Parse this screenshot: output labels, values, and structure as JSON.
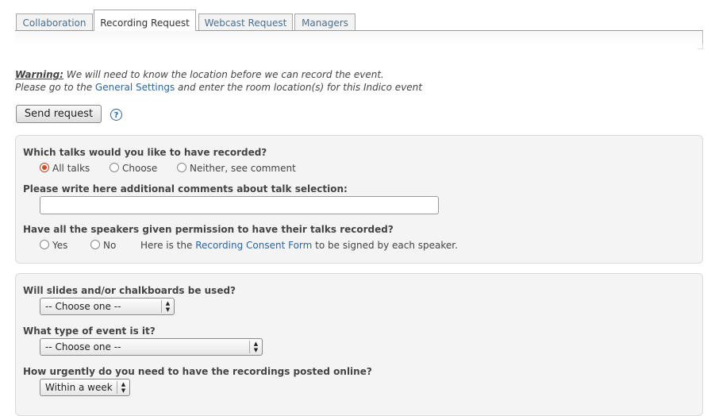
{
  "tabs": [
    {
      "label": "Collaboration"
    },
    {
      "label": "Recording Request"
    },
    {
      "label": "Webcast Request"
    },
    {
      "label": "Managers"
    }
  ],
  "warning": {
    "title": "Warning:",
    "line1": " We will need to know the location before we can record the event.",
    "line2_before": "Please go to the ",
    "line2_link": "General Settings",
    "line2_after": " and enter the room location(s) for this Indico event"
  },
  "send_button": "Send request",
  "help_glyph": "?",
  "talks": {
    "question": "Which talks would you like to have recorded?",
    "options": [
      "All talks",
      "Choose",
      "Neither, see comment"
    ],
    "selected": "All talks",
    "comment_label": "Please write here additional comments about talk selection:",
    "comment_value": ""
  },
  "permission": {
    "question": "Have all the speakers given permission to have their talks recorded?",
    "options": [
      "Yes",
      "No"
    ],
    "note_before": "Here is the ",
    "note_link": "Recording Consent Form",
    "note_after": " to be signed by each speaker."
  },
  "slides": {
    "question": "Will slides and/or chalkboards be used?",
    "selected": "-- Choose one --"
  },
  "event_type": {
    "question": "What type of event is it?",
    "selected": "-- Choose one --"
  },
  "urgency": {
    "question": "How urgently do you need to have the recordings posted online?",
    "selected": "Within a week"
  },
  "colors": {
    "link": "#2a66a1",
    "radio_selected": "#d04a1f",
    "section_bg": "#f4f4f4"
  }
}
